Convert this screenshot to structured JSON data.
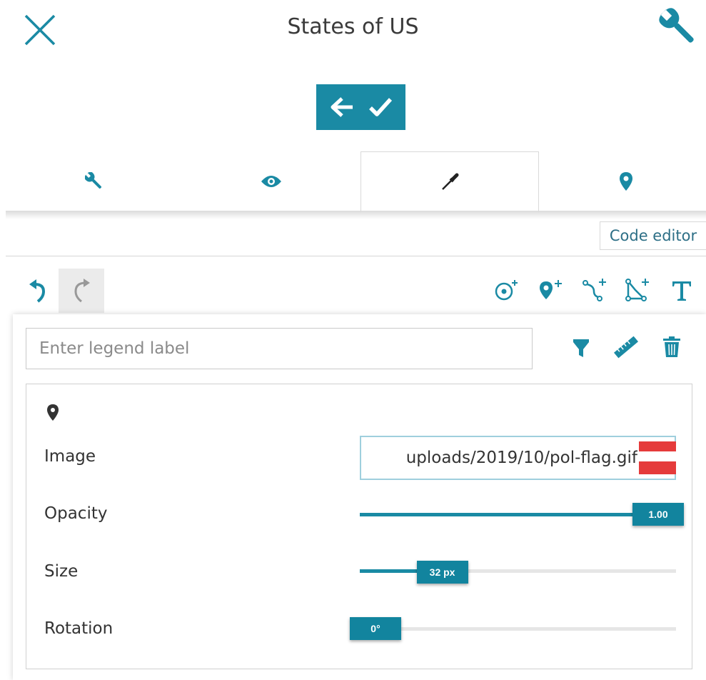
{
  "header": {
    "title": "States of US",
    "close_icon": "close-icon",
    "settings_icon": "wrench-icon"
  },
  "actions": {
    "back_icon": "arrow-left-icon",
    "confirm_icon": "checkmark-icon",
    "accent": "#1a8aa4"
  },
  "tabs": [
    {
      "icon": "wrench-icon",
      "active": false
    },
    {
      "icon": "eye-icon",
      "active": false
    },
    {
      "icon": "eyedropper-icon",
      "active": true
    },
    {
      "icon": "map-marker-icon",
      "active": false
    }
  ],
  "tooltip": {
    "text": "Code editor"
  },
  "toolbar": {
    "undo_icon": "undo-icon",
    "redo_icon": "redo-icon",
    "tools": [
      "add-circle-icon",
      "add-marker-icon",
      "add-line-icon",
      "add-polygon-icon",
      "add-text-icon"
    ]
  },
  "legend": {
    "placeholder": "Enter legend label",
    "icons": [
      "filter-icon",
      "ruler-icon",
      "trash-icon"
    ]
  },
  "properties": {
    "marker_icon": "map-marker-icon",
    "image": {
      "label": "Image",
      "value": "uploads/2019/10/pol-flag.gif"
    },
    "opacity": {
      "label": "Opacity",
      "value": 1.0,
      "display": "1.00"
    },
    "size": {
      "label": "Size",
      "value": 32,
      "display": "32 px"
    },
    "rotation": {
      "label": "Rotation",
      "value": 0,
      "display": "0°"
    }
  }
}
